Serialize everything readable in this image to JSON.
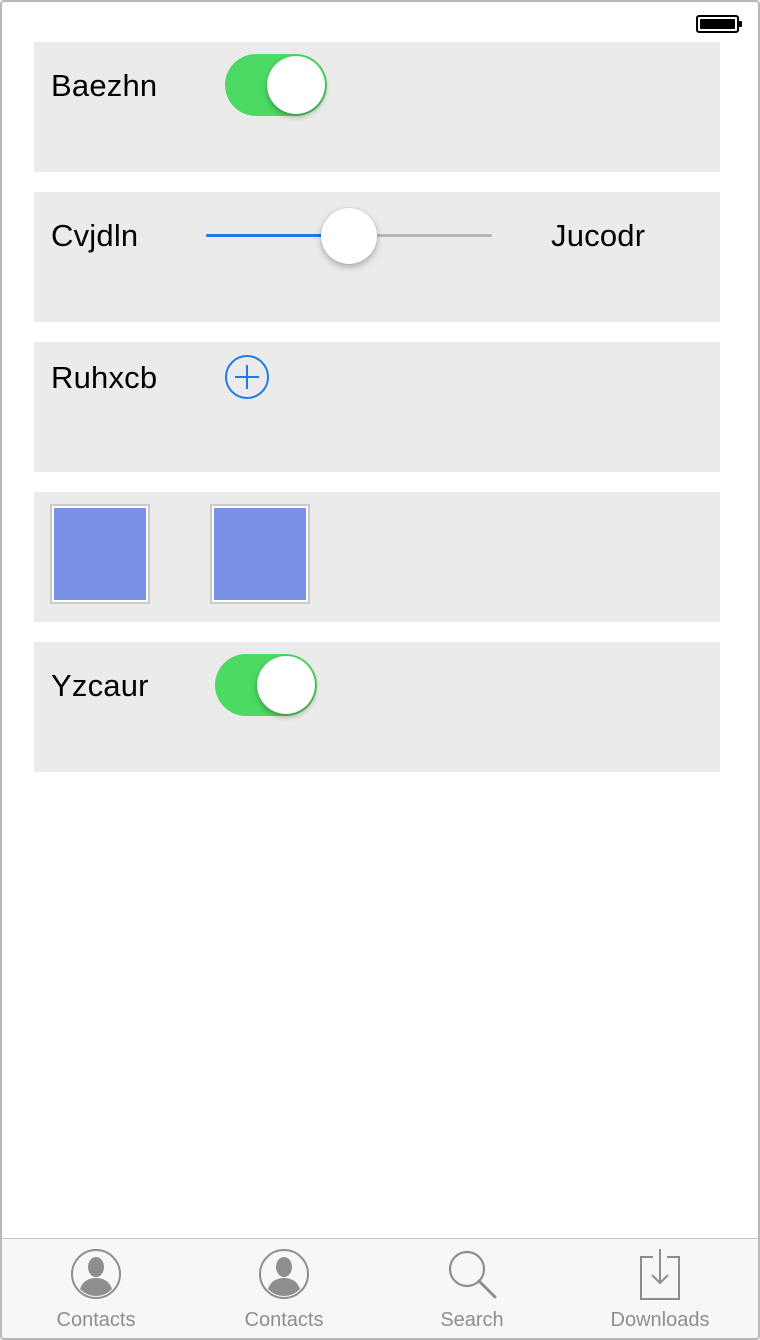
{
  "status_bar": {
    "battery_level": 1.0
  },
  "rows": [
    {
      "label": "Baezhn",
      "toggle_on": true
    },
    {
      "label": "Cvjdln",
      "slider_value": 0.5,
      "trailing_label": "Jucodr"
    },
    {
      "label": "Ruhxcb",
      "add_icon": "plus-circle-icon"
    },
    {
      "thumbnails": [
        "image-placeholder",
        "image-placeholder"
      ]
    },
    {
      "label": "Yzcaur",
      "toggle_on": true
    }
  ],
  "tabbar": {
    "items": [
      {
        "label": "Contacts",
        "icon": "contact-icon"
      },
      {
        "label": "Contacts",
        "icon": "contact-icon"
      },
      {
        "label": "Search",
        "icon": "search-icon"
      },
      {
        "label": "Downloads",
        "icon": "download-icon"
      }
    ]
  },
  "colors": {
    "toggle_on": "#4cd964",
    "accent": "#1e7ae5",
    "card_background": "#ebebeb",
    "thumbnail_fill": "#7890e6",
    "tab_inactive": "#8e8e8e"
  }
}
